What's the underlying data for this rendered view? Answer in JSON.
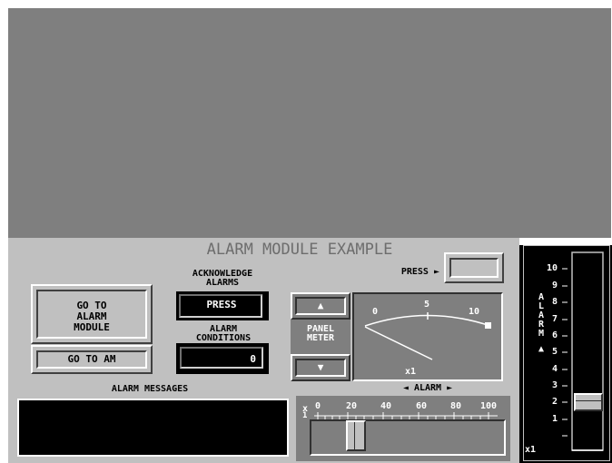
{
  "title": "ALARM MODULE EXAMPLE",
  "ack_label": "ACKNOWLEDGE ALARMS",
  "press_button": "PRESS",
  "alarm_conditions_label": "ALARM CONDITIONS",
  "alarm_conditions_value": "0",
  "go_to_alarm_module": "GO TO ALARM MODULE",
  "go_to_am": "GO TO AM",
  "alarm_messages_label": "ALARM MESSAGES",
  "press_indicator_label": "PRESS ►",
  "panel_meter_label": "PANEL METER",
  "up_arrow": "▲",
  "down_arrow": "▼",
  "meter": {
    "ticks": [
      "0",
      "5",
      "10"
    ],
    "multiplier": "x1",
    "needle_value": 0,
    "alarm_label": "◄ ALARM ►"
  },
  "slider": {
    "x_label": "x",
    "one_label": "1",
    "ticks": [
      "0",
      "20",
      "40",
      "60",
      "80",
      "100"
    ],
    "value": 20
  },
  "vertical_scale": {
    "ticks": [
      "10",
      "9",
      "8",
      "7",
      "6",
      "5",
      "4",
      "3",
      "2",
      "1"
    ],
    "alarm_letters": [
      "A",
      "L",
      "A",
      "R",
      "M"
    ],
    "arrow": "▲",
    "multiplier": "x1",
    "value": 2
  }
}
